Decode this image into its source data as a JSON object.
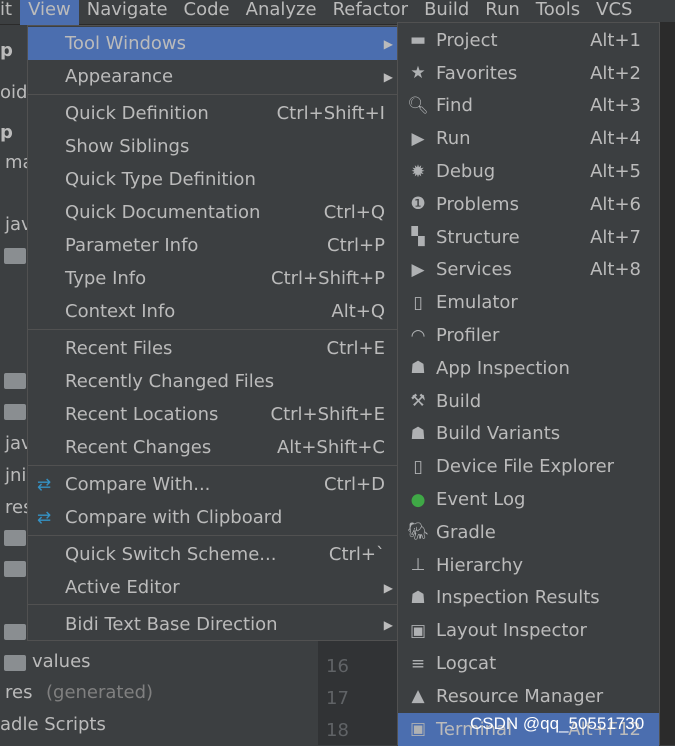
{
  "menubar": [
    "it",
    "View",
    "Navigate",
    "Code",
    "Analyze",
    "Refactor",
    "Build",
    "Run",
    "Tools",
    "VCS"
  ],
  "tree": [
    "p",
    "oid",
    "p",
    "ma",
    "jav",
    "jav",
    "jni",
    "res",
    "values",
    "res",
    "(generated)",
    "adle Scripts"
  ],
  "line_numbers": [
    "16",
    "17",
    "18"
  ],
  "view_menu": [
    {
      "label": "Tool Windows",
      "submenu": true,
      "highlighted": true
    },
    {
      "label": "Appearance",
      "submenu": true
    },
    {
      "label": "Quick Definition",
      "shortcut": "Ctrl+Shift+I"
    },
    {
      "label": "Show Siblings"
    },
    {
      "label": "Quick Type Definition"
    },
    {
      "label": "Quick Documentation",
      "shortcut": "Ctrl+Q"
    },
    {
      "label": "Parameter Info",
      "shortcut": "Ctrl+P"
    },
    {
      "label": "Type Info",
      "shortcut": "Ctrl+Shift+P"
    },
    {
      "label": "Context Info",
      "shortcut": "Alt+Q"
    },
    {
      "label": "Recent Files",
      "shortcut": "Ctrl+E"
    },
    {
      "label": "Recently Changed Files"
    },
    {
      "label": "Recent Locations",
      "shortcut": "Ctrl+Shift+E"
    },
    {
      "label": "Recent Changes",
      "shortcut": "Alt+Shift+C"
    },
    {
      "label": "Compare With...",
      "shortcut": "Ctrl+D",
      "icon": "compare-icon"
    },
    {
      "label": "Compare with Clipboard",
      "icon": "compare-clipboard-icon"
    },
    {
      "label": "Quick Switch Scheme...",
      "shortcut": "Ctrl+`"
    },
    {
      "label": "Active Editor",
      "submenu": true
    },
    {
      "label": "Bidi Text Base Direction",
      "submenu": true
    }
  ],
  "tool_windows": [
    {
      "label": "Project",
      "shortcut": "Alt+1",
      "icon": "folder-icon"
    },
    {
      "label": "Favorites",
      "shortcut": "Alt+2",
      "icon": "star-icon"
    },
    {
      "label": "Find",
      "shortcut": "Alt+3",
      "icon": "search-icon"
    },
    {
      "label": "Run",
      "shortcut": "Alt+4",
      "icon": "play-icon"
    },
    {
      "label": "Debug",
      "shortcut": "Alt+5",
      "icon": "bug-icon"
    },
    {
      "label": "Problems",
      "shortcut": "Alt+6",
      "icon": "warning-icon"
    },
    {
      "label": "Structure",
      "shortcut": "Alt+7",
      "icon": "structure-icon"
    },
    {
      "label": "Services",
      "shortcut": "Alt+8",
      "icon": "services-icon"
    },
    {
      "label": "Emulator",
      "icon": "emulator-icon"
    },
    {
      "label": "Profiler",
      "icon": "gauge-icon"
    },
    {
      "label": "App Inspection",
      "icon": "inspection-icon"
    },
    {
      "label": "Build",
      "icon": "hammer-icon"
    },
    {
      "label": "Build Variants",
      "icon": "android-icon"
    },
    {
      "label": "Device File Explorer",
      "icon": "device-icon"
    },
    {
      "label": "Event Log",
      "icon": "event-log-icon"
    },
    {
      "label": "Gradle",
      "icon": "gradle-icon"
    },
    {
      "label": "Hierarchy",
      "icon": "hierarchy-icon"
    },
    {
      "label": "Inspection Results",
      "icon": "inspection-results-icon"
    },
    {
      "label": "Layout Inspector",
      "icon": "layout-inspector-icon"
    },
    {
      "label": "Logcat",
      "icon": "logcat-icon"
    },
    {
      "label": "Resource Manager",
      "icon": "resource-manager-icon"
    },
    {
      "label": "Terminal",
      "shortcut": "Alt+F12",
      "icon": "terminal-icon",
      "highlighted": true
    }
  ],
  "watermark": "CSDN @qq_50551730",
  "colors": {
    "highlight": "#4b6eaf",
    "menu_bg": "#3c3f41",
    "text": "#bbbbbb"
  }
}
